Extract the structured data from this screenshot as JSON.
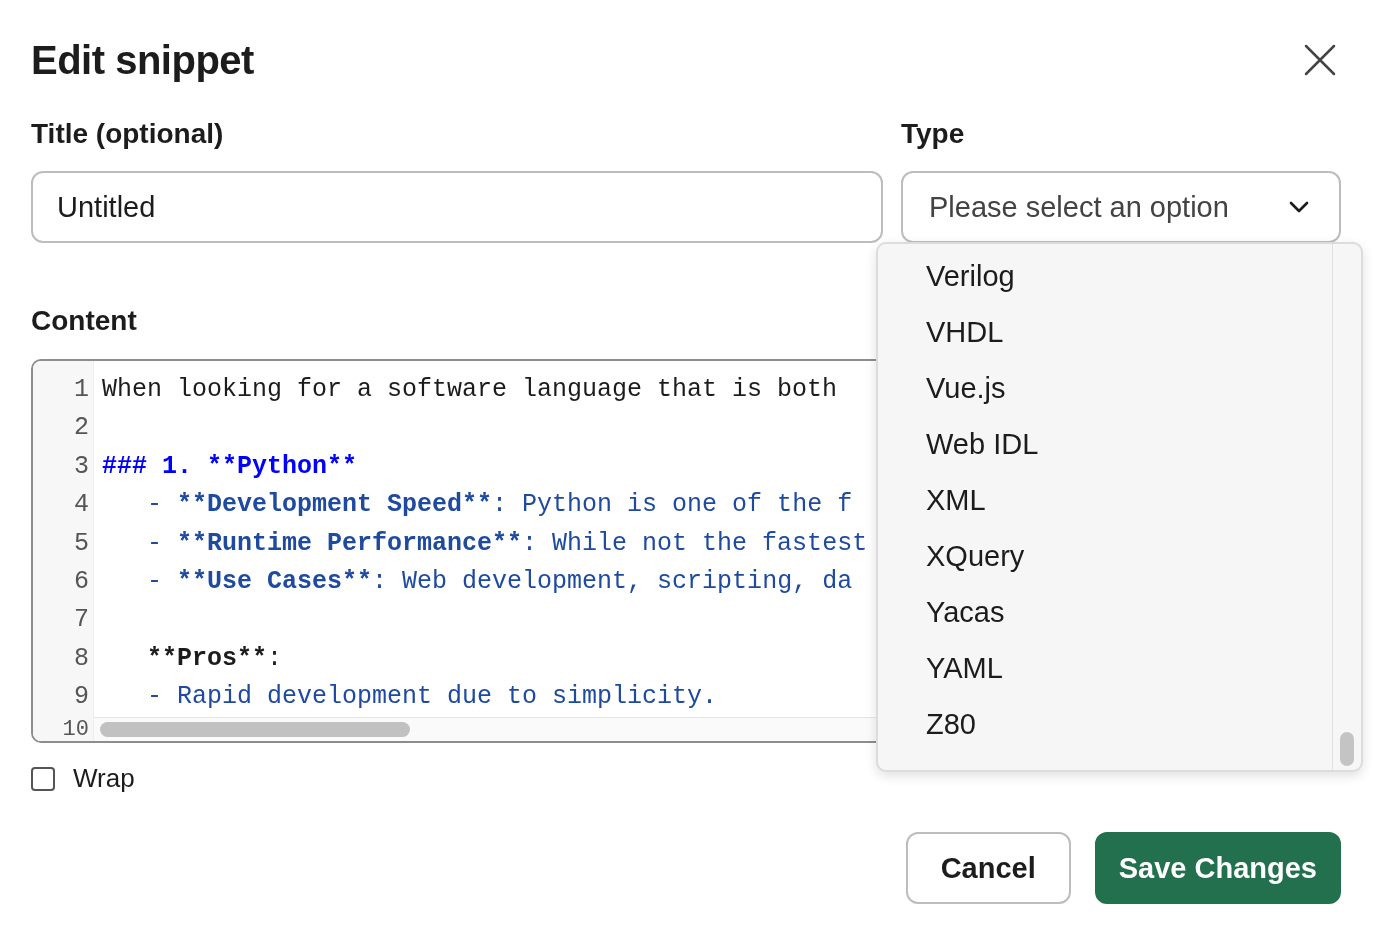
{
  "dialog": {
    "title": "Edit snippet"
  },
  "title_field": {
    "label": "Title (optional)",
    "value": "Untitled"
  },
  "type_field": {
    "label": "Type",
    "placeholder": "Please select an option",
    "expanded": true,
    "options": [
      {
        "label": "Verilog",
        "selected": false
      },
      {
        "label": "VHDL",
        "selected": false
      },
      {
        "label": "Vue.js",
        "selected": false
      },
      {
        "label": "Web IDL",
        "selected": false
      },
      {
        "label": "XML",
        "selected": false
      },
      {
        "label": "XQuery",
        "selected": false
      },
      {
        "label": "Yacas",
        "selected": false
      },
      {
        "label": "YAML",
        "selected": false
      },
      {
        "label": "Z80",
        "selected": false
      }
    ]
  },
  "content": {
    "label": "Content",
    "lines": [
      {
        "number": "1",
        "segments": [
          {
            "kind": "plain",
            "text": "When looking for a software language that is both"
          }
        ]
      },
      {
        "number": "2"
      },
      {
        "number": "3",
        "segments": [
          {
            "kind": "heading",
            "text": "### 1. **Python**"
          }
        ]
      },
      {
        "number": "4",
        "segments": [
          {
            "kind": "list",
            "text": "   - "
          },
          {
            "kind": "list-strong",
            "text": "**Development Speed**"
          },
          {
            "kind": "list",
            "text": ": Python is one of the f"
          }
        ]
      },
      {
        "number": "5",
        "segments": [
          {
            "kind": "list",
            "text": "   - "
          },
          {
            "kind": "list-strong",
            "text": "**Runtime Performance**"
          },
          {
            "kind": "list",
            "text": ": While not the fastest"
          }
        ]
      },
      {
        "number": "6",
        "segments": [
          {
            "kind": "list",
            "text": "   - "
          },
          {
            "kind": "list-strong",
            "text": "**Use Cases**"
          },
          {
            "kind": "list",
            "text": ": Web development, scripting, da"
          }
        ]
      },
      {
        "number": "7"
      },
      {
        "number": "8",
        "segments": [
          {
            "kind": "strong",
            "text": "   **Pros**"
          },
          {
            "kind": "plain",
            "text": ":"
          }
        ]
      },
      {
        "number": "9",
        "segments": [
          {
            "kind": "list",
            "text": "   - Rapid development due to simplicity."
          }
        ]
      },
      {
        "number": "10"
      }
    ]
  },
  "wrap": {
    "label": "Wrap",
    "checked": false
  },
  "buttons": [
    {
      "label": "Cancel",
      "kind": "secondary"
    },
    {
      "label": "Save Changes",
      "kind": "primary"
    }
  ]
}
